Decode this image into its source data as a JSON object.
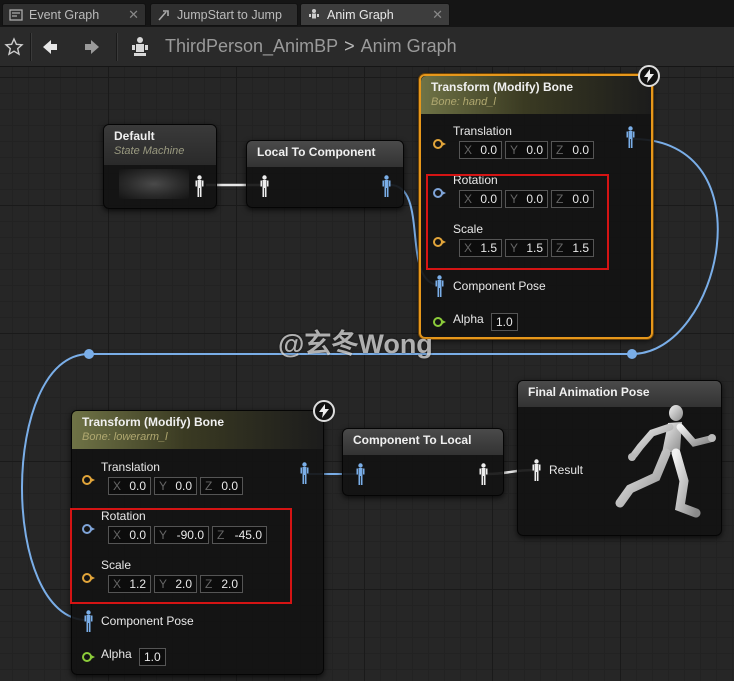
{
  "tabs": [
    {
      "label": "Event Graph",
      "icon": "event-graph-icon",
      "active": false
    },
    {
      "label": "JumpStart to Jump",
      "icon": "transition-icon",
      "active": false
    },
    {
      "label": "Anim Graph",
      "icon": "anim-graph-icon",
      "active": true
    }
  ],
  "toolbar": {
    "breadcrumb_root": "ThirdPerson_AnimBP",
    "breadcrumb_separator": ">",
    "breadcrumb_current": "Anim Graph"
  },
  "nodes": {
    "default_state_machine": {
      "title": "Default",
      "subtitle": "State Machine"
    },
    "local_to_component": {
      "title": "Local To Component"
    },
    "transform_hand": {
      "title": "Transform (Modify) Bone",
      "subtitle": "Bone: hand_l",
      "translation": {
        "label": "Translation",
        "x": "0.0",
        "y": "0.0",
        "z": "0.0"
      },
      "rotation": {
        "label": "Rotation",
        "x": "0.0",
        "y": "0.0",
        "z": "0.0"
      },
      "scale": {
        "label": "Scale",
        "x": "1.5",
        "y": "1.5",
        "z": "1.5"
      },
      "component_pose": "Component Pose",
      "alpha": {
        "label": "Alpha",
        "value": "1.0"
      }
    },
    "transform_lowerarm": {
      "title": "Transform (Modify) Bone",
      "subtitle": "Bone: lowerarm_l",
      "translation": {
        "label": "Translation",
        "x": "0.0",
        "y": "0.0",
        "z": "0.0"
      },
      "rotation": {
        "label": "Rotation",
        "x": "0.0",
        "y": "-90.0",
        "z": "-45.0"
      },
      "scale": {
        "label": "Scale",
        "x": "1.2",
        "y": "2.0",
        "z": "2.0"
      },
      "component_pose": "Component Pose",
      "alpha": {
        "label": "Alpha",
        "value": "1.0"
      }
    },
    "component_to_local": {
      "title": "Component To Local"
    },
    "final_pose": {
      "title": "Final Animation Pose",
      "result": "Result"
    }
  },
  "axes": {
    "x": "X",
    "y": "Y",
    "z": "Z"
  },
  "watermark": "@玄冬Wong",
  "colors": {
    "selection": "#e6971b",
    "highlight_box": "#d51414",
    "wire": "#7aaee8",
    "vector_pin": "#e2a53a",
    "rotator_pin": "#7fa4d8",
    "alpha_pin": "#8ccc3a"
  }
}
